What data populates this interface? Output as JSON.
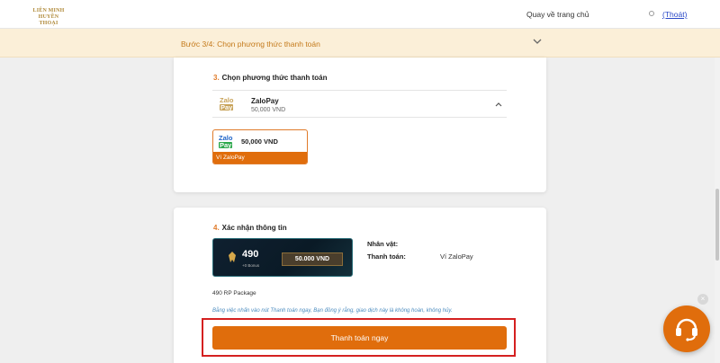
{
  "header": {
    "logo_line1": "LIÊN MINH",
    "logo_line2": "HUYỀN THOẠI",
    "home_link": "Quay về trang chủ",
    "logout": "(Thoát)"
  },
  "step": {
    "text": "Bước 3/4: Chọn phương thức thanh toán"
  },
  "payment_section": {
    "number": "3.",
    "title": "Chọn phương thức thanh toán",
    "method": {
      "logo_top": "Zalo",
      "logo_bottom": "Pay",
      "name": "ZaloPay",
      "price": "50,000 VND"
    },
    "wallet": {
      "price": "50,000 VND",
      "label": "Ví ZaloPay"
    }
  },
  "confirm_section": {
    "number": "4.",
    "title": "Xác nhận thông tin",
    "package": {
      "rp": "490",
      "bonus": "+0 Bonus",
      "price": "50.000 VND",
      "name": "490 RP Package"
    },
    "character_label": "Nhân vật:",
    "character_value": "",
    "payment_label": "Thanh toán:",
    "payment_value": "Ví ZaloPay",
    "disclaimer": "Bằng việc nhấn vào nút Thanh toán ngay, Bạn đồng ý rằng, giao dịch này là không hoàn, không hủy.",
    "pay_button": "Thanh toán ngay"
  },
  "colors": {
    "accent": "#e06d0c",
    "highlight": "#d42020",
    "step_bg": "#fbefd8"
  }
}
